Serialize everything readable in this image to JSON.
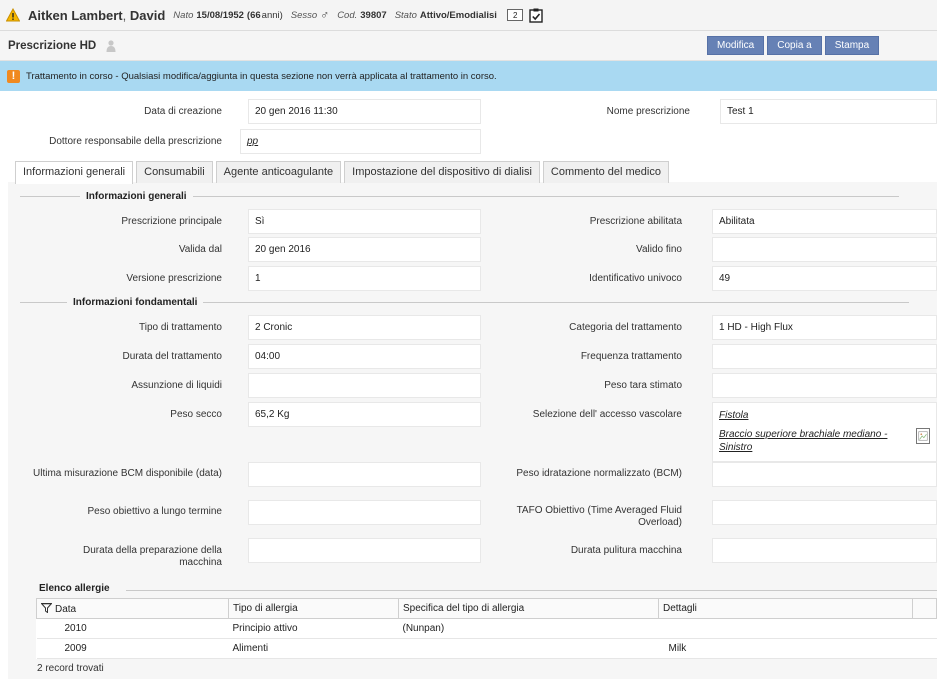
{
  "patient": {
    "name": "Aitken Lambert",
    "separator": ",",
    "first_name": "David",
    "born_label": "Nato",
    "birth_date": "15/08/1952",
    "age_value": "(66",
    "age_unit": "anni)",
    "sex_label": "Sesso",
    "sex_icon": "male-icon",
    "code_label": "Cod.",
    "code": "39807",
    "status_label": "Stato",
    "status": "Attivo/Emodialisi",
    "badge": "2"
  },
  "section": {
    "title": "Prescrizione HD",
    "buttons": [
      "Modifica",
      "Copia a",
      "Stampa"
    ]
  },
  "banner": {
    "icon": "!",
    "text": "Trattamento in corso - Qualsiasi modifica/aggiunta in questa sezione non verrà applicata al trattamento in corso."
  },
  "head_fields": {
    "creation_date_label": "Data di creazione",
    "creation_date": "20 gen 2016 11:30",
    "name_label": "Nome prescrizione",
    "name": "Test 1",
    "doctor_label": "Dottore responsabile della prescrizione",
    "doctor": "pp"
  },
  "tabs": [
    "Informazioni generali",
    "Consumabili",
    "Agente anticoagulante",
    "Impostazione del dispositivo di dialisi",
    "Commento del medico"
  ],
  "general": {
    "heading": "Informazioni generali",
    "main_label": "Prescrizione principale",
    "main": "Sì",
    "enabled_label": "Prescrizione abilitata",
    "enabled": "Abilitata",
    "valid_from_label": "Valida dal",
    "valid_from": "20 gen 2016",
    "valid_to_label": "Valido fino",
    "valid_to": "",
    "version_label": "Versione prescrizione",
    "version": "1",
    "uid_label": "Identificativo univoco",
    "uid": "49"
  },
  "fundamental": {
    "heading": "Informazioni fondamentali",
    "type_label": "Tipo di trattamento",
    "type": "2  Cronic",
    "category_label": "Categoria del trattamento",
    "category": "1  HD - High Flux",
    "duration_label": "Durata del trattamento",
    "duration": "04:00",
    "frequency_label": "Frequenza trattamento",
    "frequency": "",
    "liquid_label": "Assunzione di liquidi",
    "liquid": "",
    "tare_label": "Peso tara stimato",
    "tare": "",
    "dry_label": "Peso secco",
    "dry": "65,2  Kg",
    "access_label": "Selezione dell' accesso vascolare",
    "access_1": "Fistola",
    "access_2": "Braccio superiore brachiale mediano - Sinistro",
    "bcm_date_label": "Ultima misurazione BCM disponibile (data)",
    "bcm_date": "",
    "bcm_weight_label": "Peso idratazione normalizzato (BCM)",
    "bcm_weight": "",
    "target_label": "Peso obiettivo a lungo termine",
    "target": "",
    "tafo_label": "TAFO Obiettivo (Time Averaged Fluid Overload)",
    "tafo": "",
    "prep_label": "Durata della preparazione della macchina",
    "prep": "",
    "clean_label": "Durata pulitura macchina",
    "clean": ""
  },
  "allergies": {
    "title": "Elenco allergie",
    "columns": [
      "Data",
      "Tipo di allergia",
      "Specifica del tipo di allergia",
      "Dettagli"
    ],
    "rows": [
      [
        "2010",
        "Principio attivo",
        "(Nunpan)",
        ""
      ],
      [
        "2009",
        "Alimenti",
        "",
        "Milk"
      ]
    ],
    "count_text": "2 record trovati"
  },
  "colors": {
    "button": "#6681b5",
    "banner": "#a9d9f2",
    "banner_icon": "#f0891f",
    "warning": "#f5b700"
  }
}
